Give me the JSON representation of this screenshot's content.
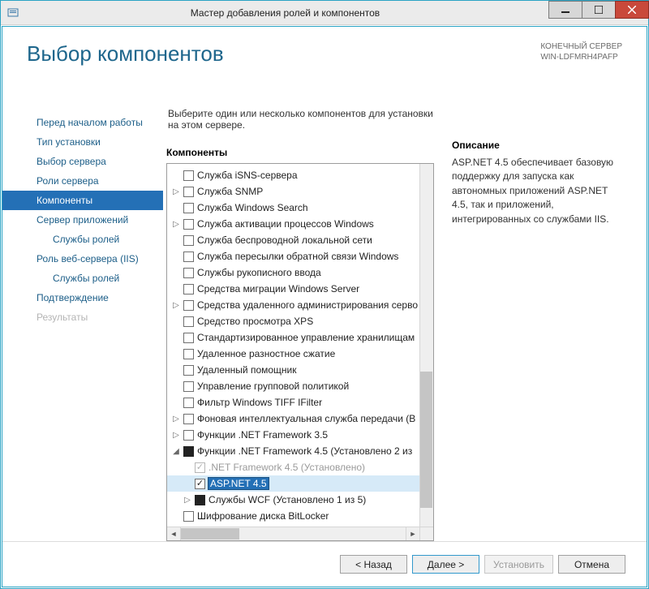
{
  "window": {
    "title": "Мастер добавления ролей и компонентов"
  },
  "header": {
    "page_title": "Выбор компонентов",
    "dest_label": "КОНЕЧНЫЙ СЕРВЕР",
    "dest_server": "WIN-LDFMRH4PAFP"
  },
  "nav": {
    "items": [
      {
        "label": "Перед началом работы",
        "selected": false,
        "sub": false,
        "disabled": false
      },
      {
        "label": "Тип установки",
        "selected": false,
        "sub": false,
        "disabled": false
      },
      {
        "label": "Выбор сервера",
        "selected": false,
        "sub": false,
        "disabled": false
      },
      {
        "label": "Роли сервера",
        "selected": false,
        "sub": false,
        "disabled": false
      },
      {
        "label": "Компоненты",
        "selected": true,
        "sub": false,
        "disabled": false
      },
      {
        "label": "Сервер приложений",
        "selected": false,
        "sub": false,
        "disabled": false
      },
      {
        "label": "Службы ролей",
        "selected": false,
        "sub": true,
        "disabled": false
      },
      {
        "label": "Роль веб-сервера (IIS)",
        "selected": false,
        "sub": false,
        "disabled": false
      },
      {
        "label": "Службы ролей",
        "selected": false,
        "sub": true,
        "disabled": false
      },
      {
        "label": "Подтверждение",
        "selected": false,
        "sub": false,
        "disabled": false
      },
      {
        "label": "Результаты",
        "selected": false,
        "sub": false,
        "disabled": true
      }
    ]
  },
  "main": {
    "intro": "Выберите один или несколько компонентов для установки на этом сервере.",
    "components_label": "Компоненты",
    "description_label": "Описание",
    "description_text": "ASP.NET 4.5 обеспечивает базовую поддержку для запуска как автономных приложений ASP.NET 4.5, так и приложений, интегрированных со службами IIS."
  },
  "tree": [
    {
      "label": "Служба iSNS-сервера",
      "indent": 0,
      "exp": "",
      "cb": "unchecked"
    },
    {
      "label": "Служба SNMP",
      "indent": 0,
      "exp": "closed",
      "cb": "unchecked"
    },
    {
      "label": "Служба Windows Search",
      "indent": 0,
      "exp": "",
      "cb": "unchecked"
    },
    {
      "label": "Служба активации процессов Windows",
      "indent": 0,
      "exp": "closed",
      "cb": "unchecked"
    },
    {
      "label": "Служба беспроводной локальной сети",
      "indent": 0,
      "exp": "",
      "cb": "unchecked"
    },
    {
      "label": "Служба пересылки обратной связи Windows",
      "indent": 0,
      "exp": "",
      "cb": "unchecked"
    },
    {
      "label": "Службы рукописного ввода",
      "indent": 0,
      "exp": "",
      "cb": "unchecked"
    },
    {
      "label": "Средства миграции Windows Server",
      "indent": 0,
      "exp": "",
      "cb": "unchecked"
    },
    {
      "label": "Средства удаленного администрирования серво",
      "indent": 0,
      "exp": "closed",
      "cb": "unchecked"
    },
    {
      "label": "Средство просмотра XPS",
      "indent": 0,
      "exp": "",
      "cb": "unchecked"
    },
    {
      "label": "Стандартизированное управление хранилищам",
      "indent": 0,
      "exp": "",
      "cb": "unchecked"
    },
    {
      "label": "Удаленное разностное сжатие",
      "indent": 0,
      "exp": "",
      "cb": "unchecked"
    },
    {
      "label": "Удаленный помощник",
      "indent": 0,
      "exp": "",
      "cb": "unchecked"
    },
    {
      "label": "Управление групповой политикой",
      "indent": 0,
      "exp": "",
      "cb": "unchecked"
    },
    {
      "label": "Фильтр Windows TIFF IFilter",
      "indent": 0,
      "exp": "",
      "cb": "unchecked"
    },
    {
      "label": "Фоновая интеллектуальная служба передачи (B",
      "indent": 0,
      "exp": "closed",
      "cb": "unchecked"
    },
    {
      "label": "Функции .NET Framework 3.5",
      "indent": 0,
      "exp": "closed",
      "cb": "unchecked"
    },
    {
      "label": "Функции .NET Framework 4.5 (Установлено 2 из",
      "indent": 0,
      "exp": "open",
      "cb": "mixed"
    },
    {
      "label": ".NET Framework 4.5 (Установлено)",
      "indent": 1,
      "exp": "",
      "cb": "checked-dis"
    },
    {
      "label": "ASP.NET 4.5",
      "indent": 1,
      "exp": "",
      "cb": "checked",
      "selected": true
    },
    {
      "label": "Службы WCF (Установлено 1 из 5)",
      "indent": 1,
      "exp": "closed",
      "cb": "mixed"
    },
    {
      "label": "Шифрование диска BitLocker",
      "indent": 0,
      "exp": "",
      "cb": "unchecked"
    }
  ],
  "footer": {
    "back": "< Назад",
    "next": "Далее >",
    "install": "Установить",
    "cancel": "Отмена"
  }
}
